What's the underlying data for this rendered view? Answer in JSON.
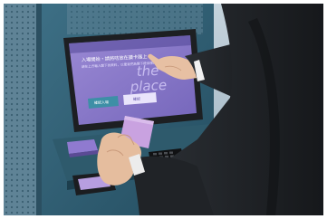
{
  "photo": {
    "subject": "Person using a self-service kiosk touchscreen while holding a purple card",
    "screen": {
      "headline": "入場開始・請將咭放在讀卡器上",
      "subline": "請在上方輸入閣下的資料，以便我們為閣下提供服務",
      "brand_line1": "the",
      "brand_line2": "place",
      "button_left": "確認入場",
      "button_right": "確認"
    },
    "colors": {
      "screen_purple": "#8a78c8",
      "screen_purple_dark": "#6d5ab0",
      "screen_teal": "#3d8fa6",
      "card_purple": "#c9a2e0",
      "kiosk_body": "#2f5f73",
      "suit": "#1f2226",
      "skin": "#e7c0a3"
    }
  }
}
